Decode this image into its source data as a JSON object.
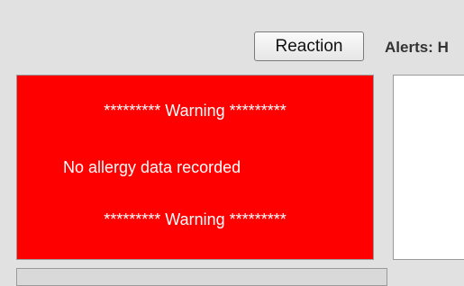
{
  "toolbar": {
    "reaction_label": "Reaction",
    "alerts_label": "Alerts: H"
  },
  "allergy_panel": {
    "warning_top": "********* Warning *********",
    "message": "No allergy data recorded",
    "warning_bottom": "********* Warning *********",
    "background_color": "#ff0000",
    "text_color": "#ffffff"
  }
}
